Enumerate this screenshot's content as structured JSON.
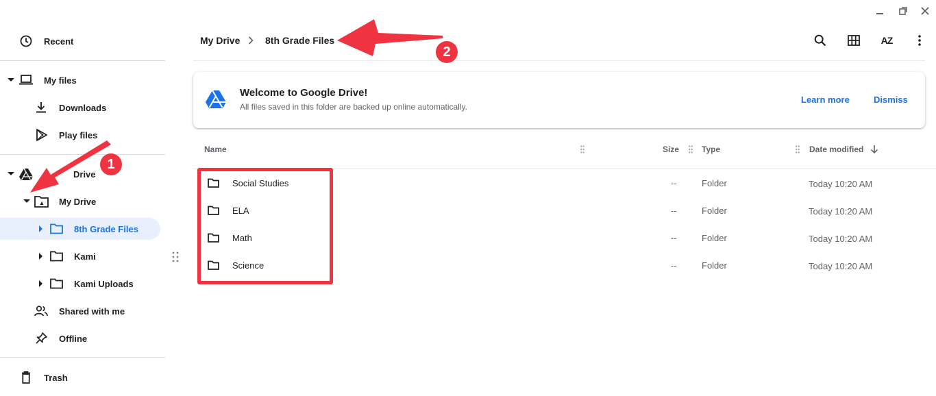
{
  "window": {
    "minimize_icon": "minimize-icon",
    "restore_icon": "restore-icon",
    "close_icon": "close-icon"
  },
  "sidebar": {
    "recent": "Recent",
    "my_files": "My files",
    "downloads": "Downloads",
    "play_files": "Play files",
    "google_drive": "Drive",
    "my_drive": "My Drive",
    "folders": [
      {
        "label": "8th Grade Files",
        "selected": true
      },
      {
        "label": "Kami",
        "selected": false
      },
      {
        "label": "Kami Uploads",
        "selected": false
      }
    ],
    "shared_with_me": "Shared with me",
    "offline": "Offline",
    "trash": "Trash"
  },
  "breadcrumb": {
    "root": "My Drive",
    "current": "8th Grade Files"
  },
  "toolbar": {
    "search_icon": "search-icon",
    "grid_icon": "grid-view-icon",
    "sort_label": "AZ",
    "more_icon": "more-vert-icon"
  },
  "banner": {
    "title": "Welcome to Google Drive!",
    "text": "All files saved in this folder are backed up online automatically.",
    "learn_more": "Learn more",
    "dismiss": "Dismiss"
  },
  "table": {
    "headers": {
      "name": "Name",
      "size": "Size",
      "type": "Type",
      "date_modified": "Date modified"
    },
    "rows": [
      {
        "name": "Social Studies",
        "size": "--",
        "type": "Folder",
        "date": "Today 10:20 AM"
      },
      {
        "name": "ELA",
        "size": "--",
        "type": "Folder",
        "date": "Today 10:20 AM"
      },
      {
        "name": "Math",
        "size": "--",
        "type": "Folder",
        "date": "Today 10:20 AM"
      },
      {
        "name": "Science",
        "size": "--",
        "type": "Folder",
        "date": "Today 10:20 AM"
      }
    ]
  },
  "annotations": {
    "badge_1": "1",
    "badge_2": "2"
  },
  "colors": {
    "accent": "#1a73e8",
    "annotation_red": "#ef3340",
    "selected_bg": "#e8f0fe"
  }
}
